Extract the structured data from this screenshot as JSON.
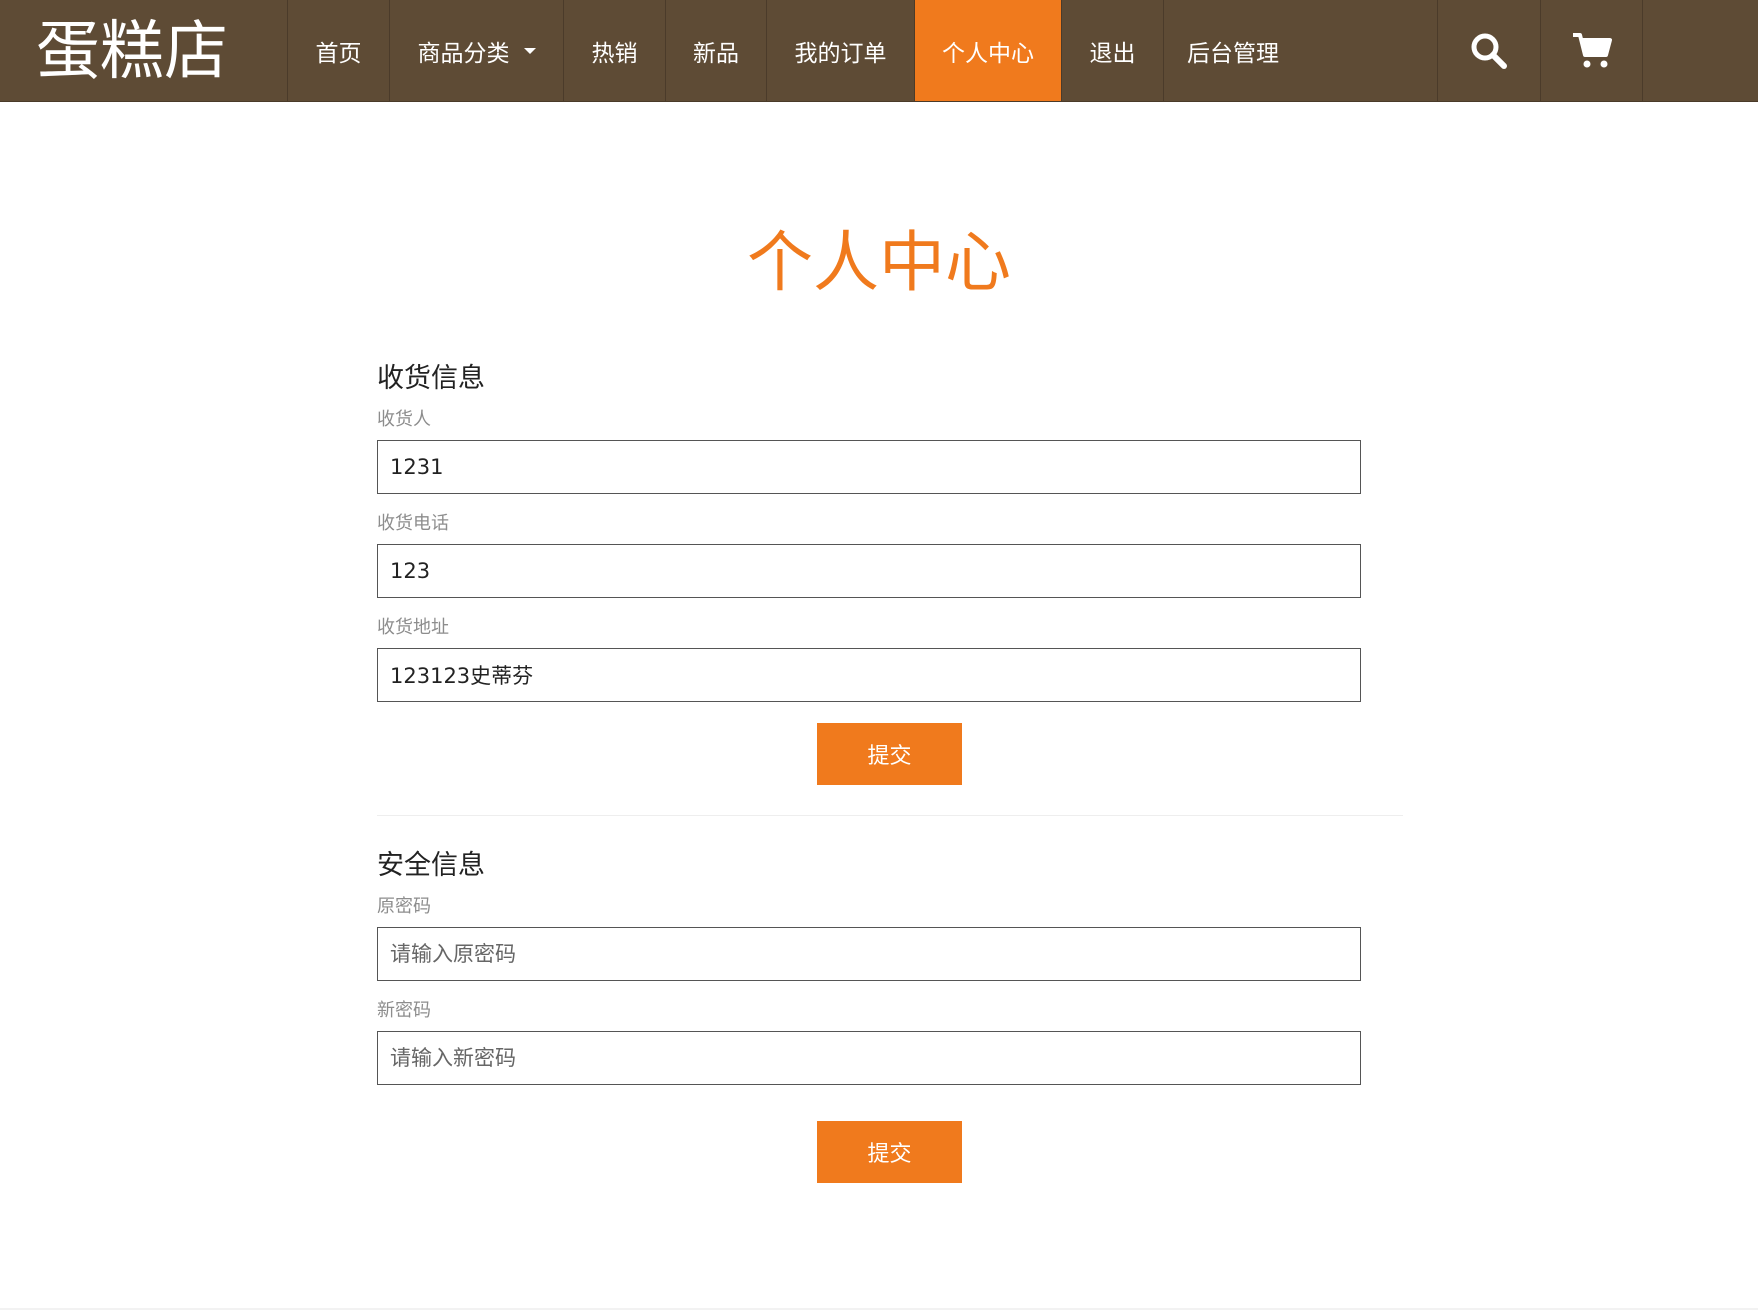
{
  "brand": "蛋糕店",
  "nav": {
    "items": [
      {
        "label": "首页"
      },
      {
        "label": "商品分类"
      },
      {
        "label": "热销"
      },
      {
        "label": "新品"
      },
      {
        "label": "我的订单"
      },
      {
        "label": "个人中心"
      },
      {
        "label": "退出"
      },
      {
        "label": "后台管理"
      }
    ],
    "active_index": 5,
    "icons": [
      "search-icon",
      "cart-icon"
    ]
  },
  "page_title": "个人中心",
  "shipping": {
    "title": "收货信息",
    "name_label": "收货人",
    "name_value": "1231",
    "phone_label": "收货电话",
    "phone_value": "123",
    "address_label": "收货地址",
    "address_value": "123123史蒂芬",
    "submit_label": "提交"
  },
  "security": {
    "title": "安全信息",
    "old_label": "原密码",
    "old_placeholder": "请输入原密码",
    "new_label": "新密码",
    "new_placeholder": "请输入新密码",
    "submit_label": "提交"
  },
  "colors": {
    "nav_bg": "#5e4b35",
    "accent": "#f07a1d"
  }
}
